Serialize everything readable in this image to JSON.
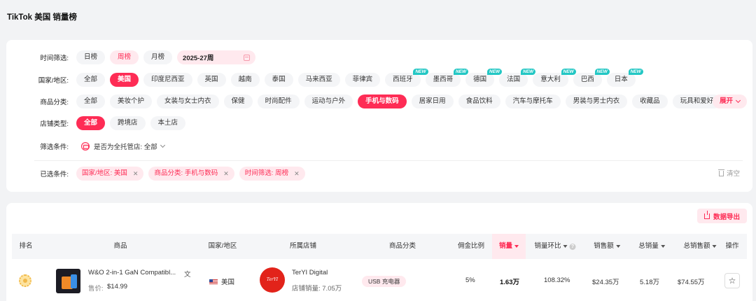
{
  "page_title": "TikTok 美国 销量榜",
  "filters": {
    "time": {
      "label": "时间筛选:",
      "options": [
        "日榜",
        "周榜",
        "月榜"
      ],
      "date_value": "2025-27周"
    },
    "country": {
      "label": "国家/地区:",
      "options": [
        {
          "text": "全部",
          "new": ""
        },
        {
          "text": "美国",
          "new": ""
        },
        {
          "text": "印度尼西亚",
          "new": ""
        },
        {
          "text": "英国",
          "new": ""
        },
        {
          "text": "越南",
          "new": ""
        },
        {
          "text": "泰国",
          "new": ""
        },
        {
          "text": "马来西亚",
          "new": ""
        },
        {
          "text": "菲律宾",
          "new": ""
        },
        {
          "text": "西班牙",
          "new": "NEW"
        },
        {
          "text": "墨西哥",
          "new": "NEW"
        },
        {
          "text": "德国",
          "new": "NEW"
        },
        {
          "text": "法国",
          "new": "NEW"
        },
        {
          "text": "意大利",
          "new": "NEW"
        },
        {
          "text": "巴西",
          "new": "NEW"
        },
        {
          "text": "日本",
          "new": "NEW"
        }
      ]
    },
    "category": {
      "label": "商品分类:",
      "options": [
        "全部",
        "美妆个护",
        "女装与女士内衣",
        "保健",
        "时尚配件",
        "运动与户外",
        "手机与数码",
        "居家日用",
        "食品饮料",
        "汽车与摩托车",
        "男装与男士内衣",
        "收藏品",
        "玩具和爱好"
      ],
      "expand_label": "展开"
    },
    "store_type": {
      "label": "店铺类型:",
      "options": [
        "全部",
        "跨境店",
        "本土店"
      ]
    },
    "conditions": {
      "label": "筛选条件:",
      "selector_text": "是否为全托管店: 全部"
    },
    "selected": {
      "label": "已选条件:",
      "tags": [
        "国家/地区: 美国",
        "商品分类: 手机与数码",
        "时间筛选: 周榜"
      ],
      "clear_label": "清空"
    }
  },
  "table": {
    "export_label": "数据导出",
    "columns": [
      "排名",
      "商品",
      "国家/地区",
      "所属店铺",
      "商品分类",
      "佣金比例",
      "销量",
      "销量环比",
      "销售额",
      "总销量",
      "总销售额",
      "操作"
    ],
    "rows": [
      {
        "product_name": "W&O 2-in-1 GaN Compatibl...",
        "price_label": "售价:",
        "price": "$14.99",
        "country": "美国",
        "shop_name": "TerYI Digital",
        "shop_logo_text": "TerYI Digital",
        "shop_sales": "店铺销量: 7.05万",
        "category": "USB 充电器",
        "commission": "5%",
        "sales": "1.63万",
        "sales_change": "108.32%",
        "revenue": "$24.35万",
        "total_sales": "5.18万",
        "total_revenue": "$74.55万"
      }
    ]
  },
  "icons": {
    "rank": "medal-icon",
    "favorite": "star-icon",
    "calendar": "calendar-icon",
    "export": "export-icon"
  },
  "colors": {
    "accent": "#fe2c55",
    "accent_soft": "#ffe9ee",
    "new_badge": "#23c7c4"
  }
}
